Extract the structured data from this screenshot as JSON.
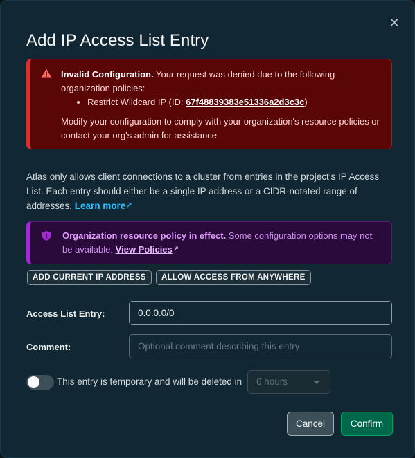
{
  "dialog": {
    "title": "Add IP Access List Entry",
    "close_glyph": "✕"
  },
  "error_banner": {
    "heading": "Invalid Configuration.",
    "message": " Your request was denied due to the following organization policies:",
    "policy_item_prefix": "Restrict Wildcard IP (ID: ",
    "policy_id": "67f48839383e51336a2d3c3c",
    "policy_item_suffix": ")",
    "guidance": "Modify your configuration to comply with your organization's resource policies or contact your org's admin for assistance."
  },
  "description": {
    "text": "Atlas only allows client connections to a cluster from entries in the project’s IP Access List. Each entry should either be a single IP address or a CIDR-notated range of addresses. ",
    "learn_more": "Learn more"
  },
  "policy_banner": {
    "heading": "Organization resource policy in effect.",
    "message": " Some configuration options may not be available. ",
    "view_policies": "View Policies"
  },
  "quick_actions": {
    "add_current_ip": "ADD CURRENT IP ADDRESS",
    "allow_anywhere": "ALLOW ACCESS FROM ANYWHERE"
  },
  "form": {
    "entry_label": "Access List Entry:",
    "entry_value": "0.0.0.0/0",
    "comment_label": "Comment:",
    "comment_placeholder": "Optional comment describing this entry",
    "temporary_text": "This entry is temporary and will be deleted in",
    "temporary_enabled": false,
    "duration_value": "6 hours"
  },
  "footer": {
    "cancel": "Cancel",
    "confirm": "Confirm"
  },
  "colors": {
    "dialog_bg": "#112733",
    "error_bg": "#5a0607",
    "error_accent": "#db3030",
    "policy_bg": "#2a0a3a",
    "policy_accent": "#a42ad8",
    "link": "#2dc1ff",
    "confirm_bg": "#00684a"
  }
}
